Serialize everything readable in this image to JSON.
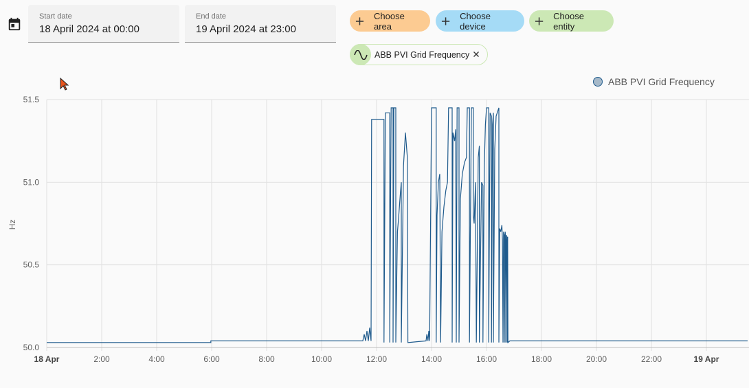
{
  "date_picker": {
    "start_label": "Start date",
    "start_value": "18 April 2024 at 00:00",
    "end_label": "End date",
    "end_value": "19 April 2024 at 23:00"
  },
  "target_picker": {
    "choose_area": "Choose area",
    "choose_device": "Choose device",
    "choose_entity": "Choose entity",
    "selected_entity": "ABB PVI Grid Frequency",
    "area_color": "#fccb92",
    "device_color": "#a5dbf6",
    "entity_color": "#cce8b5"
  },
  "icons": {
    "calendar": "calendar-icon",
    "plus": "plus-icon",
    "sine_wave": "sine-wave-icon",
    "close": "close-icon",
    "cursor": "mouse-cursor-icon"
  },
  "chart_data": {
    "type": "line",
    "ylabel": "Hz",
    "ylim": [
      50.0,
      51.5
    ],
    "yticks": [
      "51.5",
      "51.0",
      "50.5",
      "50.0"
    ],
    "x_range_hours": [
      0,
      25.5
    ],
    "xticks": [
      {
        "label": "18 Apr",
        "hour": 0,
        "bold": true
      },
      {
        "label": "2:00",
        "hour": 2,
        "bold": false
      },
      {
        "label": "4:00",
        "hour": 4,
        "bold": false
      },
      {
        "label": "6:00",
        "hour": 6,
        "bold": false
      },
      {
        "label": "8:00",
        "hour": 8,
        "bold": false
      },
      {
        "label": "10:00",
        "hour": 10,
        "bold": false
      },
      {
        "label": "12:00",
        "hour": 12,
        "bold": false
      },
      {
        "label": "14:00",
        "hour": 14,
        "bold": false
      },
      {
        "label": "16:00",
        "hour": 16,
        "bold": false
      },
      {
        "label": "18:00",
        "hour": 18,
        "bold": false
      },
      {
        "label": "20:00",
        "hour": 20,
        "bold": false
      },
      {
        "label": "22:00",
        "hour": 22,
        "bold": false
      },
      {
        "label": "19 Apr",
        "hour": 24,
        "bold": true
      }
    ],
    "grid": true,
    "legend_position": "top-right",
    "series": [
      {
        "name": "ABB PVI Grid Frequency",
        "color": "#1e5a8c",
        "step": true,
        "points": [
          [
            0,
            50.03
          ],
          [
            5.97,
            50.03
          ],
          [
            5.97,
            50.04
          ],
          [
            11.5,
            50.04
          ],
          [
            11.55,
            50.08
          ],
          [
            11.6,
            50.04
          ],
          [
            11.65,
            50.1
          ],
          [
            11.7,
            50.04
          ],
          [
            11.75,
            50.12
          ],
          [
            11.8,
            50.04
          ],
          [
            11.82,
            51.38
          ],
          [
            12.27,
            51.38
          ],
          [
            12.27,
            50.03
          ],
          [
            12.32,
            51.42
          ],
          [
            12.48,
            51.42
          ],
          [
            12.48,
            50.03
          ],
          [
            12.53,
            51.45
          ],
          [
            12.6,
            51.45
          ],
          [
            12.6,
            50.03
          ],
          [
            12.63,
            51.45
          ],
          [
            12.7,
            51.45
          ],
          [
            12.7,
            50.03
          ],
          [
            12.76,
            50.7
          ],
          [
            12.8,
            50.78
          ],
          [
            12.86,
            50.92
          ],
          [
            12.9,
            51.0
          ],
          [
            12.9,
            50.03
          ],
          [
            12.98,
            51.1
          ],
          [
            13.05,
            51.3
          ],
          [
            13.12,
            51.15
          ],
          [
            13.14,
            50.03
          ],
          [
            13.8,
            50.04
          ],
          [
            13.83,
            50.08
          ],
          [
            13.87,
            50.04
          ],
          [
            13.9,
            50.1
          ],
          [
            13.93,
            50.04
          ],
          [
            14.0,
            51.45
          ],
          [
            14.17,
            51.45
          ],
          [
            14.17,
            50.03
          ],
          [
            14.2,
            50.8
          ],
          [
            14.25,
            51.0
          ],
          [
            14.3,
            51.05
          ],
          [
            14.33,
            50.03
          ],
          [
            14.38,
            50.7
          ],
          [
            14.45,
            50.85
          ],
          [
            14.52,
            50.95
          ],
          [
            14.58,
            51.0
          ],
          [
            14.62,
            51.45
          ],
          [
            14.75,
            51.45
          ],
          [
            14.75,
            50.03
          ],
          [
            14.78,
            51.3
          ],
          [
            14.84,
            51.25
          ],
          [
            14.88,
            51.32
          ],
          [
            14.9,
            50.03
          ],
          [
            14.93,
            51.45
          ],
          [
            15.0,
            51.45
          ],
          [
            15.0,
            50.03
          ],
          [
            15.05,
            50.9
          ],
          [
            15.12,
            51.05
          ],
          [
            15.2,
            51.12
          ],
          [
            15.27,
            51.15
          ],
          [
            15.3,
            51.45
          ],
          [
            15.38,
            51.45
          ],
          [
            15.38,
            50.03
          ],
          [
            15.45,
            51.45
          ],
          [
            15.52,
            51.45
          ],
          [
            15.52,
            50.8
          ],
          [
            15.55,
            50.75
          ],
          [
            15.6,
            51.0
          ],
          [
            15.63,
            50.03
          ],
          [
            15.7,
            51.15
          ],
          [
            15.74,
            51.22
          ],
          [
            15.74,
            50.03
          ],
          [
            15.82,
            51.0
          ],
          [
            15.87,
            50.98
          ],
          [
            15.87,
            50.03
          ],
          [
            15.92,
            51.1
          ],
          [
            15.96,
            51.35
          ],
          [
            16.0,
            51.45
          ],
          [
            16.08,
            51.45
          ],
          [
            16.08,
            50.03
          ],
          [
            16.13,
            51.42
          ],
          [
            16.18,
            51.4
          ],
          [
            16.18,
            50.03
          ],
          [
            16.22,
            51.35
          ],
          [
            16.25,
            51.42
          ],
          [
            16.25,
            50.03
          ],
          [
            16.3,
            51.2
          ],
          [
            16.35,
            51.4
          ],
          [
            16.45,
            51.45
          ],
          [
            16.45,
            50.03
          ],
          [
            16.48,
            50.72
          ],
          [
            16.52,
            50.7
          ],
          [
            16.56,
            50.74
          ],
          [
            16.58,
            50.65
          ],
          [
            16.6,
            50.03
          ],
          [
            16.62,
            50.7
          ],
          [
            16.65,
            50.68
          ],
          [
            16.65,
            50.03
          ],
          [
            16.68,
            50.7
          ],
          [
            16.7,
            50.65
          ],
          [
            16.7,
            50.03
          ],
          [
            16.73,
            50.68
          ],
          [
            16.75,
            50.66
          ],
          [
            16.75,
            50.03
          ],
          [
            16.77,
            50.67
          ],
          [
            16.78,
            50.03
          ],
          [
            16.85,
            50.04
          ],
          [
            20.53,
            50.04
          ],
          [
            20.53,
            50.04
          ],
          [
            25.5,
            50.04
          ]
        ]
      }
    ]
  }
}
